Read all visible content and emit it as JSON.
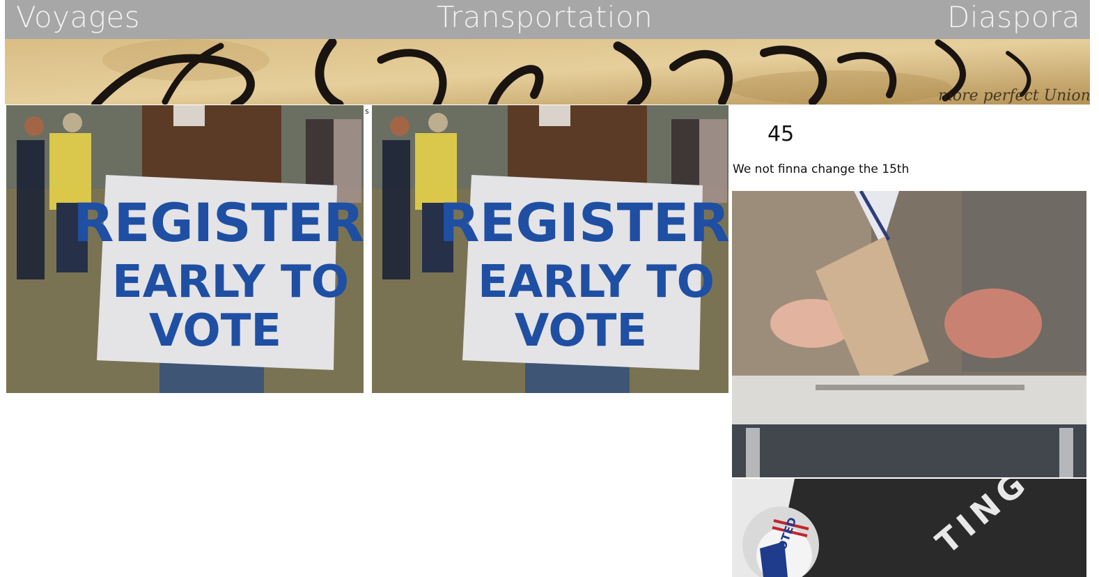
{
  "nav": {
    "left": "Voyages",
    "center": "Transportation",
    "right": "Diaspora"
  },
  "banner": {
    "script_text": "We the People",
    "sub_text": "more perfect Union"
  },
  "gallery": {
    "sign_line1": "REGISTER",
    "sign_line2": "EARLY TO",
    "sign_line3": "VOTE",
    "separator_mark": "s"
  },
  "side": {
    "number": "45",
    "caption": "We not finna change the 15th",
    "sticker_text": "VOTED",
    "box_text": "TING"
  },
  "colors": {
    "nav_bg": "#a7a7a7",
    "nav_text": "#f2f2f2",
    "sign_ink": "#1f4fa3",
    "sign_board": "#e4e3e6"
  }
}
